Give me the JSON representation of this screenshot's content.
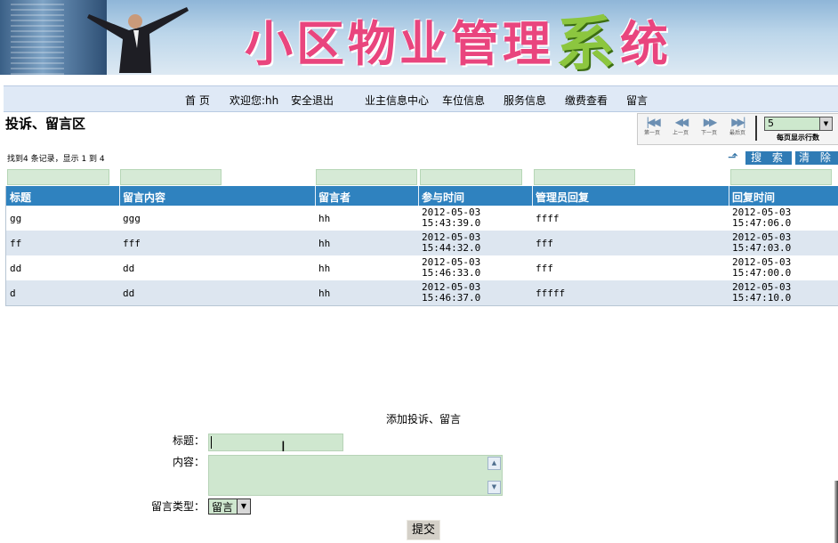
{
  "banner": {
    "title": "小区物业管理系统",
    "title_head": "小区物业管理",
    "title_mid": "系",
    "title_tail": "统"
  },
  "nav": {
    "items": [
      "首 页",
      "欢迎您:hh",
      "安全退出",
      "业主信息中心",
      "车位信息",
      "服务信息",
      "缴费查看",
      "留言"
    ]
  },
  "section": {
    "title": "投诉、留言区"
  },
  "pager": {
    "first": "第一页",
    "prev": "上一页",
    "next": "下一页",
    "last": "最后页",
    "rows_per_page": "5",
    "rows_label": "每页显示行数"
  },
  "records": {
    "summary": "找到4 条记录，显示 1 到 4"
  },
  "toolbar": {
    "search_label": "搜 索",
    "clear_label": "清 除"
  },
  "table": {
    "columns": [
      "标题",
      "留言内容",
      "留言者",
      "参与时间",
      "管理员回复",
      "回复时间"
    ],
    "rows": [
      {
        "title": "gg",
        "content": "ggg",
        "author": "hh",
        "time_date": "2012-05-03",
        "time_clock": "15:43:39.0",
        "reply": "ffff",
        "reply_date": "2012-05-03",
        "reply_clock": "15:47:06.0"
      },
      {
        "title": "ff",
        "content": "fff",
        "author": "hh",
        "time_date": "2012-05-03",
        "time_clock": "15:44:32.0",
        "reply": "fff",
        "reply_date": "2012-05-03",
        "reply_clock": "15:47:03.0"
      },
      {
        "title": "dd",
        "content": "dd",
        "author": "hh",
        "time_date": "2012-05-03",
        "time_clock": "15:46:33.0",
        "reply": "fff",
        "reply_date": "2012-05-03",
        "reply_clock": "15:47:00.0"
      },
      {
        "title": "d",
        "content": "dd",
        "author": "hh",
        "time_date": "2012-05-03",
        "time_clock": "15:46:37.0",
        "reply": "fffff",
        "reply_date": "2012-05-03",
        "reply_clock": "15:47:10.0"
      }
    ]
  },
  "form": {
    "heading": "添加投诉、留言",
    "title_label": "标题：",
    "title_value": "",
    "content_label": "内容：",
    "content_value": "",
    "type_label": "留言类型：",
    "type_value": "留言",
    "submit_label": "提交"
  },
  "colors": {
    "header_blue": "#2f82bf",
    "nav_bg": "#dfe9f6",
    "input_green": "#cfe7cf",
    "alt_row": "#dde6f0",
    "banner_pink": "#e9457e",
    "banner_green": "#8cc63f"
  },
  "icons": [
    "first-page-icon",
    "prev-page-icon",
    "next-page-icon",
    "last-page-icon",
    "export-icon",
    "scroll-up-icon",
    "scroll-down-icon",
    "dropdown-arrow-icon",
    "text-cursor-icon"
  ]
}
